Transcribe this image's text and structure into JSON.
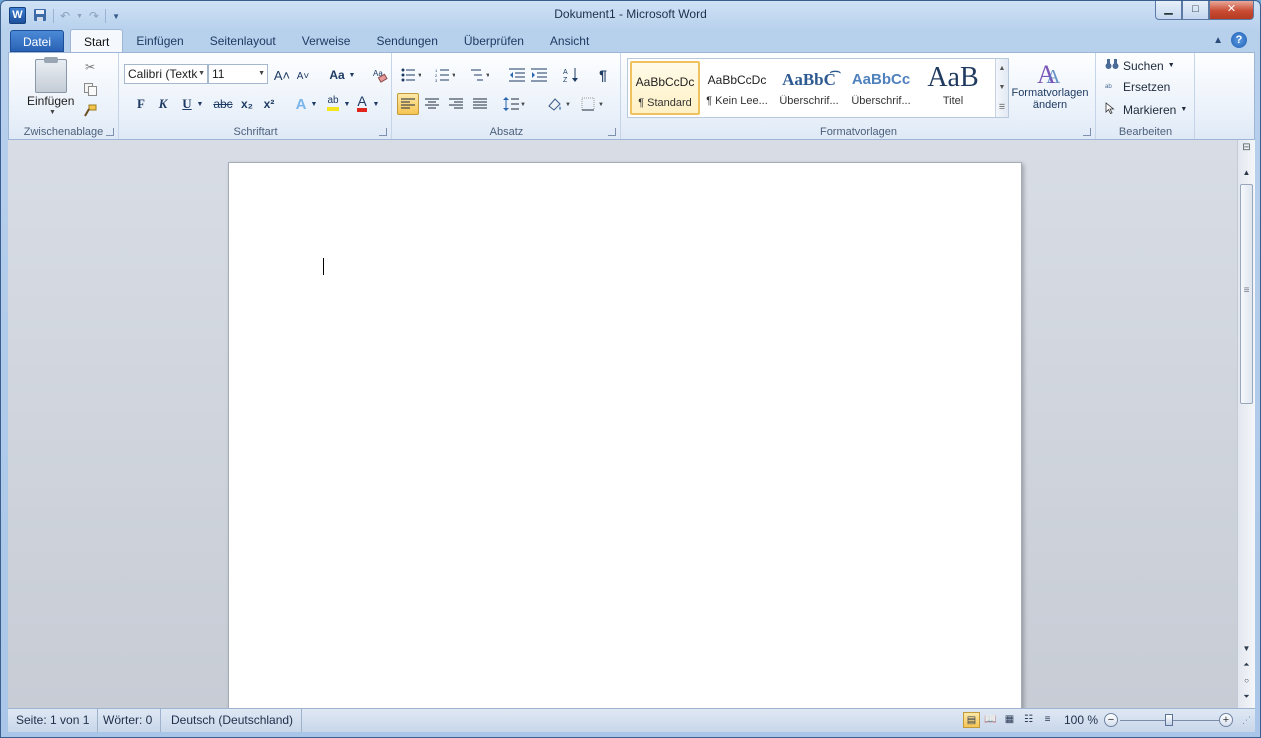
{
  "window": {
    "title": "Dokument1 - Microsoft Word",
    "app_icon_letter": "W",
    "qat": {
      "save_icon": "floppy-disk",
      "undo_icon": "undo-arrow",
      "redo_icon": "redo-arrow",
      "customize_icon": "chevron-down"
    },
    "controls": {
      "minimize": "▁",
      "maximize": "□",
      "close": "✕"
    }
  },
  "tabs": {
    "file": "Datei",
    "items": [
      "Start",
      "Einfügen",
      "Seitenlayout",
      "Verweise",
      "Sendungen",
      "Überprüfen",
      "Ansicht"
    ],
    "active": "Start",
    "help": "?"
  },
  "ribbon": {
    "clipboard": {
      "label": "Zwischenablage",
      "paste": "Einfügen"
    },
    "font": {
      "label": "Schriftart",
      "font_name": "Calibri (Textk",
      "font_size": "11",
      "grow": "A˄",
      "shrink": "A˅",
      "case": "Aa",
      "bold": "F",
      "italic": "K",
      "underline": "U",
      "strike": "abc",
      "subscript": "x₂",
      "superscript": "x²",
      "text_effects": "A",
      "highlight": "ab",
      "font_color": "A",
      "highlight_color": "#f5e51f",
      "font_color_value": "#e0261c"
    },
    "paragraph": {
      "label": "Absatz",
      "pilcrow": "¶"
    },
    "styles": {
      "label": "Formatvorlagen",
      "items": [
        {
          "sample": "AaBbCcDc",
          "name": "¶ Standard"
        },
        {
          "sample": "AaBbCcDc",
          "name": "¶ Kein Lee..."
        },
        {
          "sample": "AaBbC͡",
          "name": "Überschrif..."
        },
        {
          "sample": "AaBbCc",
          "name": "Überschrif..."
        },
        {
          "sample": "AaB",
          "name": "Titel"
        }
      ],
      "change_label_1": "Formatvorlagen",
      "change_label_2": "ändern"
    },
    "editing": {
      "label": "Bearbeiten",
      "find": "Suchen",
      "replace": "Ersetzen",
      "select": "Markieren"
    }
  },
  "statusbar": {
    "page": "Seite: 1 von 1",
    "words": "Wörter: 0",
    "language": "Deutsch (Deutschland)",
    "zoom": "100 %",
    "zoom_minus": "−",
    "zoom_plus": "+"
  }
}
